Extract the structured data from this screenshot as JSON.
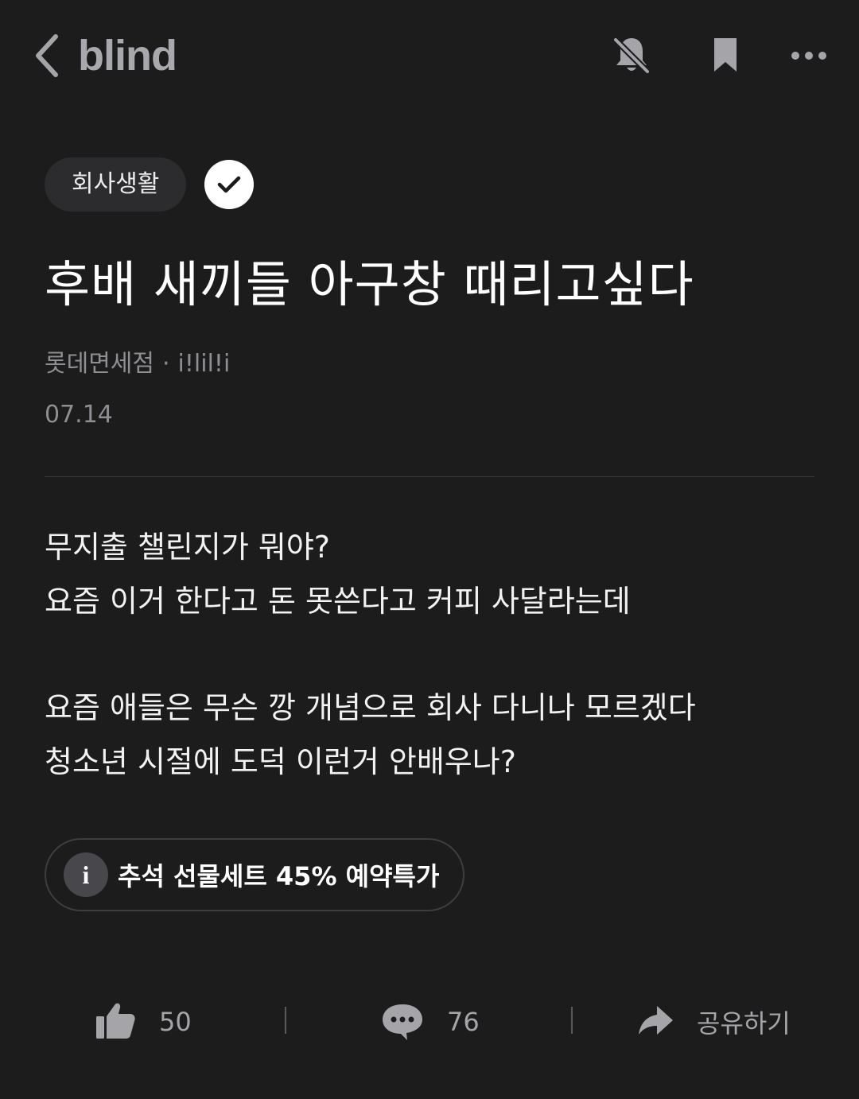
{
  "header": {
    "logo_text": "blind",
    "icons": [
      "back-chevron-icon",
      "bell-off-icon",
      "bookmark-icon",
      "more-dots-icon"
    ]
  },
  "post": {
    "category": "회사생활",
    "title": "후배 새끼들 아구창 때리고싶다",
    "company": "롯데면세점",
    "separator": "·",
    "author": "i!lil!i",
    "date": "07.14",
    "body_paragraphs": [
      [
        "무지출 챌린지가 뭐야?",
        "요즘 이거 한다고 돈 못쓴다고 커피 사달라는데"
      ],
      [
        "요즘 애들은 무슨 깡 개념으로 회사 다니나 모르겠다",
        "청소년 시절에 도덕 이런거 안배우나?"
      ]
    ]
  },
  "ad": {
    "icon": "i",
    "text": "추석 선물세트 45% 예약특가"
  },
  "actions": {
    "like_count": "50",
    "comment_count": "76",
    "share_label": "공유하기"
  },
  "colors": {
    "background": "#1c1c1d",
    "text_primary": "#ffffff",
    "text_secondary": "#8e8e93",
    "chip_bg": "#2c2c2e",
    "icon_gray": "#a5a5a9"
  }
}
